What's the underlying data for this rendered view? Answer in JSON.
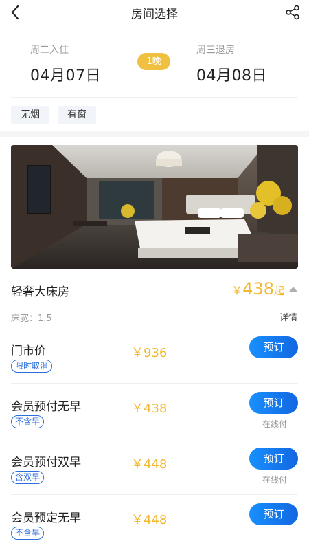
{
  "nav": {
    "title": "房间选择",
    "back_icon": "back-arrow-icon",
    "share_icon": "share-icon"
  },
  "dates": {
    "checkin_label": "周二入住",
    "checkin_date": "04月07日",
    "nights": "1晚",
    "checkout_label": "周三退房",
    "checkout_date": "04月08日"
  },
  "filters": [
    "无烟",
    "有窗"
  ],
  "room": {
    "name": "轻奢大床房",
    "currency": "￥",
    "price": "438",
    "price_suffix": "起",
    "bed": "床宽：1.5",
    "detail": "详情"
  },
  "rates": [
    {
      "name": "门市价",
      "badge": "限时取消",
      "price": "￥936",
      "button": "预订",
      "pay": ""
    },
    {
      "name": "会员预付无早",
      "badge": "不含早",
      "price": "￥438",
      "button": "预订",
      "pay": "在线付"
    },
    {
      "name": "会员预付双早",
      "badge": "含双早",
      "price": "￥448",
      "button": "预订",
      "pay": "在线付"
    },
    {
      "name": "会员预定无早",
      "badge": "不含早",
      "price": "￥448",
      "button": "预订",
      "pay": ""
    }
  ],
  "colors": {
    "accent_blue": "#1366e0",
    "price_gold": "#f2b831",
    "nights_badge": "#f0c040"
  }
}
